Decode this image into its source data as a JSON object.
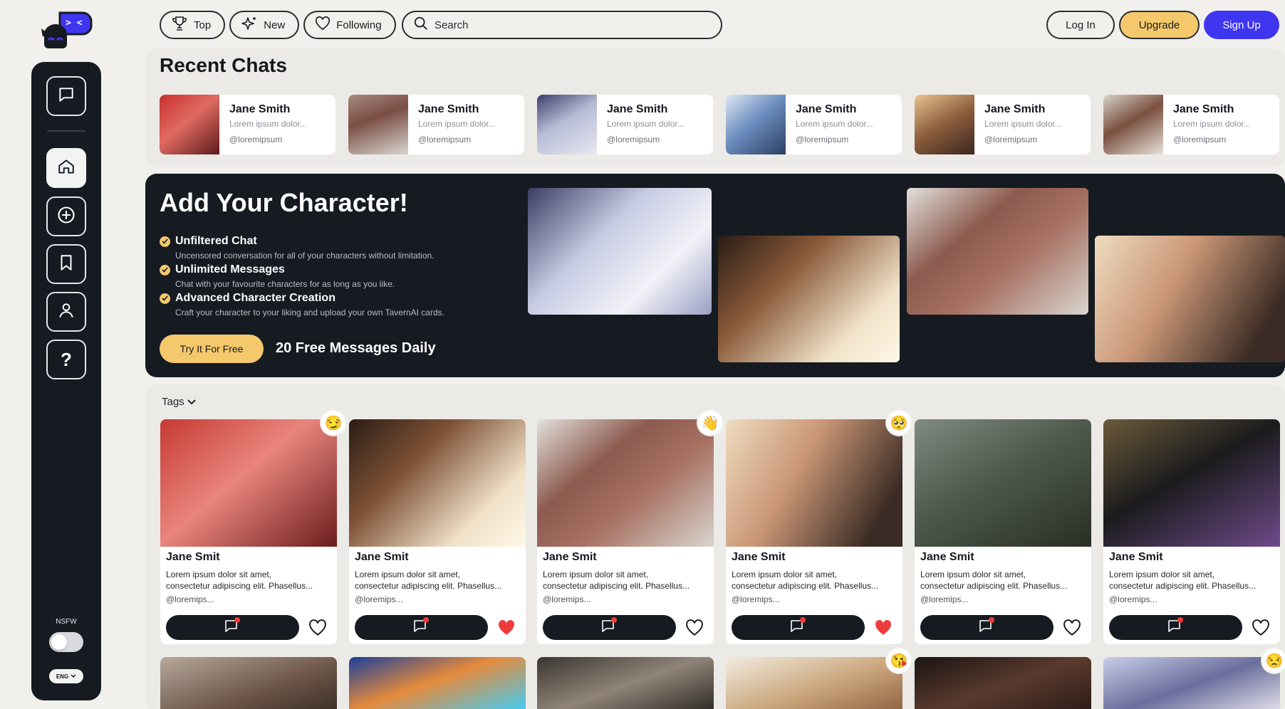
{
  "app": {
    "logo_icon": "robot-face-logo"
  },
  "sidebar": {
    "items": [
      {
        "icon": "chat-bubble-icon"
      },
      {
        "icon": "home-icon"
      },
      {
        "icon": "plus-circle-icon"
      },
      {
        "icon": "bookmark-icon"
      },
      {
        "icon": "user-icon"
      },
      {
        "icon": "question-icon"
      }
    ],
    "nsfw_label": "NSFW",
    "nsfw_enabled": false,
    "language": "ENG"
  },
  "topbar": {
    "filters": [
      {
        "label": "Top",
        "icon": "trophy-icon"
      },
      {
        "label": "New",
        "icon": "sparkle-icon"
      },
      {
        "label": "Following",
        "icon": "heart-icon"
      }
    ],
    "search_label": "Search",
    "login": "Log In",
    "upgrade": "Upgrade",
    "signup": "Sign Up"
  },
  "recent": {
    "title": "Recent Chats",
    "items": [
      {
        "name": "Jane Smith",
        "snippet": "Lorem ipsum dolor...",
        "handle": "@loremipsum"
      },
      {
        "name": "Jane Smith",
        "snippet": "Lorem ipsum dolor...",
        "handle": "@loremipsum"
      },
      {
        "name": "Jane Smith",
        "snippet": "Lorem ipsum dolor...",
        "handle": "@loremipsum"
      },
      {
        "name": "Jane Smith",
        "snippet": "Lorem ipsum dolor...",
        "handle": "@loremipsum"
      },
      {
        "name": "Jane Smith",
        "snippet": "Lorem ipsum dolor...",
        "handle": "@loremipsum"
      },
      {
        "name": "Jane Smith",
        "snippet": "Lorem ipsum dolor...",
        "handle": "@loremipsum"
      }
    ]
  },
  "banner": {
    "title": "Add Your Character!",
    "features": [
      {
        "title": "Unfiltered Chat",
        "desc": "Uncensored conversation for all of your characters without limitation."
      },
      {
        "title": "Unlimited Messages",
        "desc": "Chat with your favourite characters for as long as you like."
      },
      {
        "title": "Advanced Character Creation",
        "desc": "Craft your character to your liking and upload your own TavernAI cards."
      }
    ],
    "cta": "Try It For Free",
    "free_messages": "20 Free Messages Daily"
  },
  "grid": {
    "tags_label": "Tags",
    "cards": [
      {
        "name": "Jane Smit",
        "desc1": "Lorem ipsum dolor sit amet,",
        "desc2": "consectetur adipiscing elit. Phasellus...",
        "handle": "@loremips...",
        "liked": false,
        "emoji": "😏"
      },
      {
        "name": "Jane Smit",
        "desc1": "Lorem ipsum dolor sit amet,",
        "desc2": "consectetur adipiscing elit. Phasellus...",
        "handle": "@loremips...",
        "liked": true,
        "emoji": ""
      },
      {
        "name": "Jane Smit",
        "desc1": "Lorem ipsum dolor sit amet,",
        "desc2": "consectetur adipiscing elit. Phasellus...",
        "handle": "@loremips...",
        "liked": false,
        "emoji": "👋"
      },
      {
        "name": "Jane Smit",
        "desc1": "Lorem ipsum dolor sit amet,",
        "desc2": "consectetur adipiscing elit. Phasellus...",
        "handle": "@loremips...",
        "liked": true,
        "emoji": "🥺"
      },
      {
        "name": "Jane Smit",
        "desc1": "Lorem ipsum dolor sit amet,",
        "desc2": "consectetur adipiscing elit. Phasellus...",
        "handle": "@loremips...",
        "liked": false,
        "emoji": ""
      },
      {
        "name": "Jane Smit",
        "desc1": "Lorem ipsum dolor sit amet,",
        "desc2": "consectetur adipiscing elit. Phasellus...",
        "handle": "@loremips...",
        "liked": false,
        "emoji": ""
      }
    ],
    "row2_emojis": [
      "",
      "",
      "",
      "😘",
      "",
      "😒"
    ]
  },
  "colors": {
    "accent_yellow": "#f5c86c",
    "accent_blue": "#3f36f0",
    "dark": "#161b22",
    "heart_red": "#ee3b3b"
  }
}
